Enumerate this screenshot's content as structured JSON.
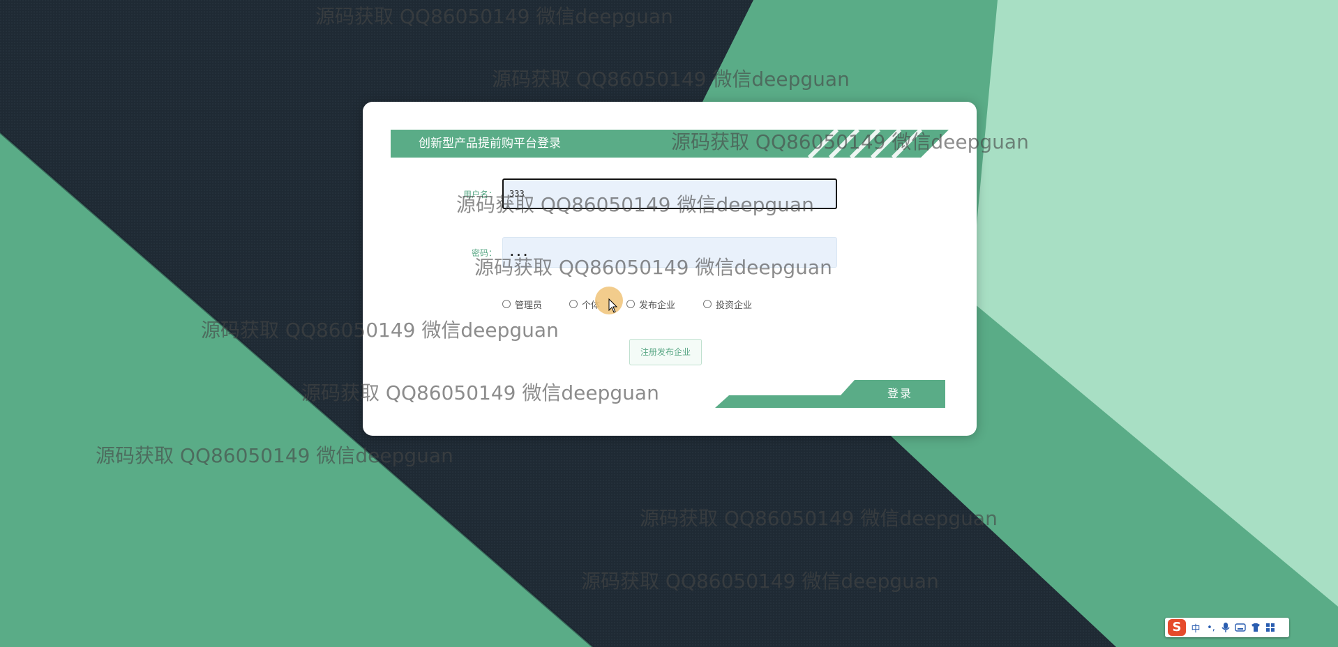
{
  "login": {
    "title": "创新型产品提前购平台登录",
    "username_label": "用户名：",
    "username_value": "333",
    "password_label": "密码：",
    "password_value": "...",
    "roles": [
      "管理员",
      "个体",
      "发布企业",
      "投资企业"
    ],
    "register_label": "注册发布企业",
    "login_label": "登录"
  },
  "watermark_text": "源码获取 QQ86050149 微信deepguan",
  "ime": {
    "logo": "S",
    "mode": "中",
    "punct": "•,",
    "mic": "mic-icon",
    "keyboard": "keyboard-icon",
    "skin": "shirt-icon",
    "menu": "grid-icon"
  },
  "colors": {
    "accent_green": "#5aac87",
    "dark_background": "#1f2a34",
    "light_green": "#a8dfc4"
  }
}
